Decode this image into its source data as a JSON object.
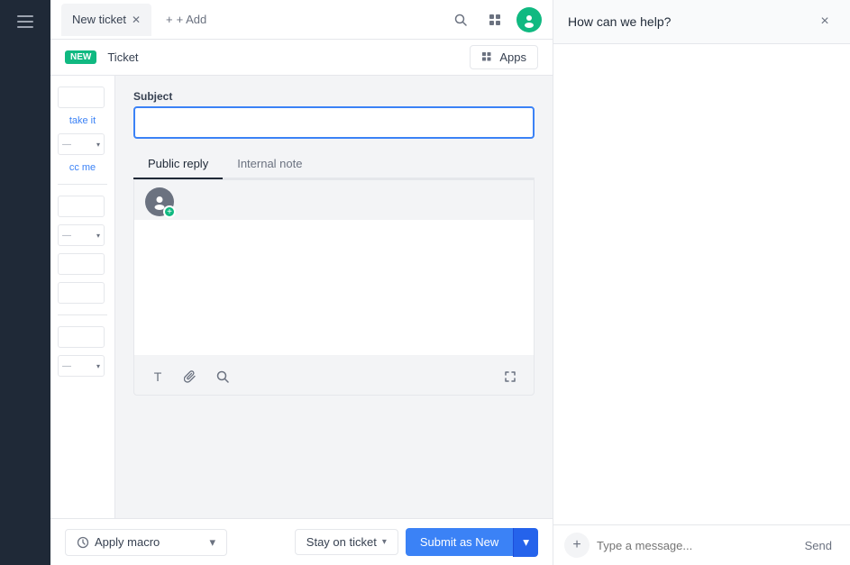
{
  "app": {
    "title": "New ticket"
  },
  "tabs": [
    {
      "label": "New ticket",
      "active": true
    }
  ],
  "add_btn": "+ Add",
  "top_bar_icons": {
    "search": "🔍",
    "grid": "⊞",
    "display": "⬜"
  },
  "sub_bar": {
    "badge": "NEW",
    "ticket_label": "Ticket",
    "apps_label": "Apps"
  },
  "left_panel": {
    "take_it": "take it",
    "cc_me": "cc me"
  },
  "form": {
    "subject_label": "Subject",
    "subject_placeholder": "",
    "reply_tab_public": "Public reply",
    "reply_tab_internal": "Internal note",
    "textarea_placeholder": ""
  },
  "toolbar": {
    "text_icon": "T",
    "attach_icon": "📎",
    "search_icon": "🔍",
    "expand_icon": "⤢"
  },
  "bottom": {
    "macro_icon": "⚙",
    "macro_label": "Apply macro",
    "macro_arrow": "▾",
    "stay_label": "Stay on ticket",
    "stay_arrow": "▾",
    "submit_label": "Submit as New",
    "submit_arrow": "▾"
  },
  "help_panel": {
    "title": "How can we help?",
    "close_label": "×",
    "message_placeholder": "Type a message...",
    "send_label": "Send"
  }
}
